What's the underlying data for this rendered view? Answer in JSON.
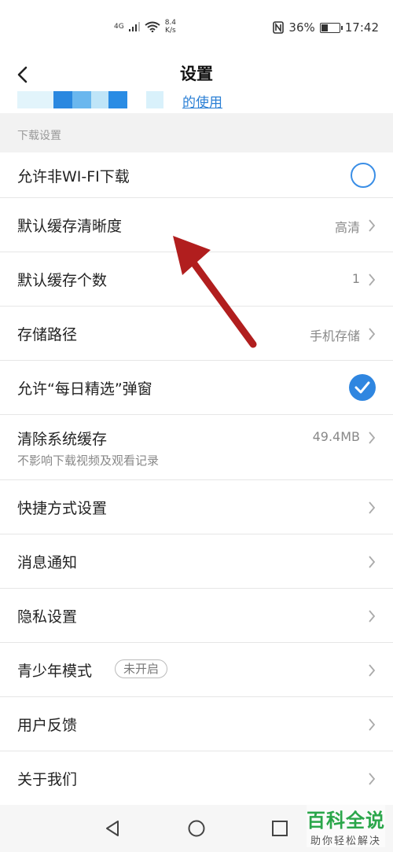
{
  "status_bar": {
    "network": "4G",
    "speed_value": "8.4",
    "speed_unit": "K/s",
    "battery": "36%",
    "time": "17:42"
  },
  "header": {
    "title": "设置"
  },
  "banner": {
    "link_text": "的使用"
  },
  "section": {
    "download_header": "下载设置"
  },
  "items": {
    "allow_non_wifi": {
      "label": "允许非WI-FI下载",
      "enabled": false
    },
    "default_cache_quality": {
      "label": "默认缓存清晰度",
      "value": "高清"
    },
    "default_cache_count": {
      "label": "默认缓存个数",
      "value": "1"
    },
    "storage_path": {
      "label": "存储路径",
      "value": "手机存储"
    },
    "daily_picks_popup": {
      "label": "允许“每日精选”弹窗",
      "enabled": true
    },
    "clear_cache": {
      "label": "清除系统缓存",
      "value": "49.4MB",
      "sub": "不影响下载视频及观看记录"
    },
    "shortcut_settings": {
      "label": "快捷方式设置"
    },
    "notifications": {
      "label": "消息通知"
    },
    "privacy": {
      "label": "隐私设置"
    },
    "teen_mode": {
      "label": "青少年模式",
      "badge": "未开启"
    },
    "feedback": {
      "label": "用户反馈"
    },
    "about": {
      "label": "关于我们"
    }
  },
  "watermark": {
    "main": "百科全说",
    "sub": "助你轻松解决"
  },
  "colors": {
    "accent": "#2f86e0",
    "annotation_arrow": "#b11e1e",
    "watermark_green": "#2aa64a"
  }
}
